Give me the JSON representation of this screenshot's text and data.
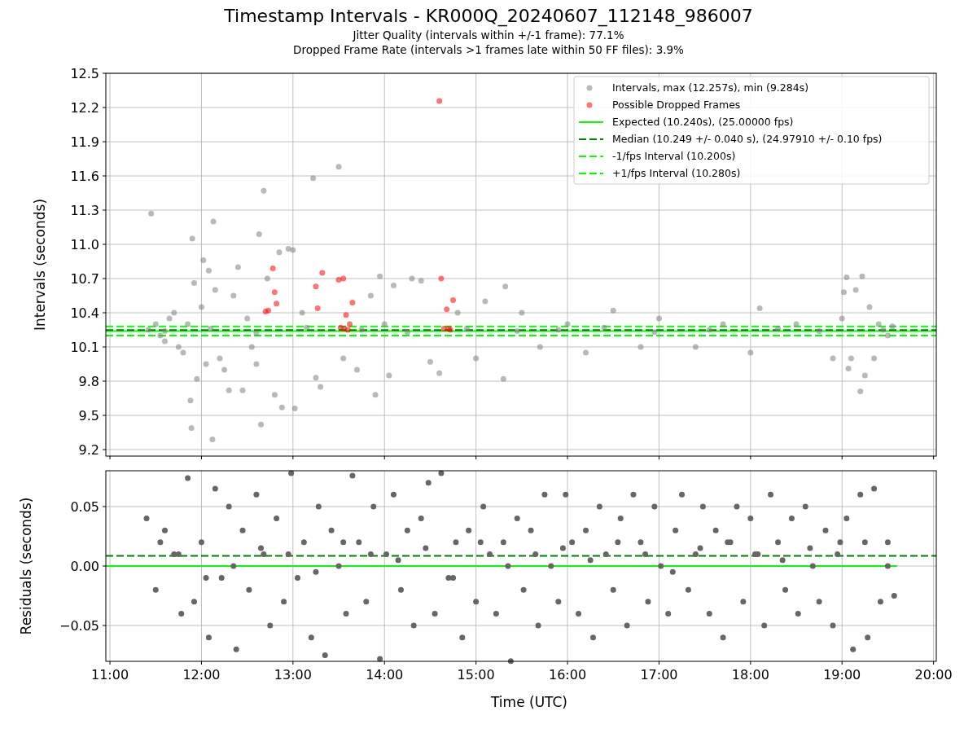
{
  "figure": {
    "title": "Timestamp Intervals - KR000Q_20240607_112148_986007",
    "subtitles": [
      "Jitter Quality (intervals within +/-1 frame): 77.1%",
      "Dropped Frame Rate (intervals >1 frames late within 50 FF files): 3.9%"
    ]
  },
  "charts": [
    {
      "chart_data": {
        "type": "scatter",
        "ylabel": "Intervals (seconds)",
        "xlim": [
          10.955,
          20.03
        ],
        "ylim": [
          9.143,
          12.5
        ],
        "grid": true,
        "legend": true,
        "yticks": [
          {
            "value": 9.2,
            "label": "9.2"
          },
          {
            "value": 9.5,
            "label": "9.5"
          },
          {
            "value": 9.8,
            "label": "9.8"
          },
          {
            "value": 10.1,
            "label": "10.1"
          },
          {
            "value": 10.4,
            "label": "10.4"
          },
          {
            "value": 10.7,
            "label": "10.7"
          },
          {
            "value": 11.0,
            "label": "11.0"
          },
          {
            "value": 11.3,
            "label": "11.3"
          },
          {
            "value": 11.6,
            "label": "11.6"
          },
          {
            "value": 11.9,
            "label": "11.9"
          },
          {
            "value": 12.2,
            "label": "12.2"
          },
          {
            "value": 12.5,
            "label": "12.5"
          }
        ],
        "series": [
          {
            "name": "Intervals, max (12.257s), min (9.284s)",
            "type": "scatter",
            "color": "#808080",
            "x": [
              11.45,
              11.42,
              11.5,
              11.55,
              11.6,
              11.65,
              11.7,
              11.75,
              11.8,
              11.85,
              11.88,
              11.89,
              11.9,
              11.92,
              11.95,
              12.0,
              12.02,
              12.05,
              12.08,
              12.12,
              12.13,
              12.15,
              12.2,
              12.25,
              12.3,
              12.35,
              12.4,
              12.45,
              12.5,
              12.55,
              12.6,
              12.63,
              12.65,
              12.68,
              12.72,
              12.8,
              12.85,
              12.88,
              12.95,
              13.0,
              13.02,
              13.1,
              13.22,
              13.25,
              13.3,
              13.5,
              13.55,
              13.7,
              13.85,
              13.9,
              13.95,
              14.0,
              14.05,
              14.1,
              14.3,
              14.4,
              14.5,
              14.6,
              14.8,
              15.0,
              15.1,
              15.3,
              15.32,
              15.5,
              15.7,
              16.0,
              16.2,
              16.5,
              16.8,
              17.0,
              17.4,
              17.7,
              18.0,
              18.1,
              18.5,
              18.9,
              19.0,
              19.02,
              19.05,
              19.07,
              19.1,
              19.15,
              19.2,
              19.22,
              19.25,
              19.3,
              19.35,
              19.4,
              19.5,
              19.55,
              11.6,
              12.1,
              12.6,
              13.15,
              13.75,
              14.25,
              14.9,
              15.45,
              15.9,
              16.4,
              16.95,
              17.55,
              18.3,
              18.75,
              19.45
            ],
            "values": [
              11.27,
              10.25,
              10.3,
              10.2,
              10.15,
              10.35,
              10.4,
              10.1,
              10.05,
              10.3,
              9.63,
              9.39,
              11.05,
              10.66,
              9.82,
              10.45,
              10.86,
              9.95,
              10.77,
              9.29,
              11.2,
              10.6,
              10.0,
              9.9,
              9.72,
              10.55,
              10.8,
              9.72,
              10.35,
              10.1,
              9.95,
              11.09,
              9.42,
              11.47,
              10.7,
              9.68,
              10.93,
              9.57,
              10.96,
              10.95,
              9.56,
              10.4,
              11.58,
              9.83,
              9.75,
              11.68,
              10.0,
              9.9,
              10.55,
              9.68,
              10.72,
              10.3,
              9.85,
              10.64,
              10.7,
              10.68,
              9.97,
              9.87,
              10.4,
              10.0,
              10.5,
              9.82,
              10.63,
              10.4,
              10.1,
              10.3,
              10.05,
              10.42,
              10.1,
              10.35,
              10.1,
              10.3,
              10.05,
              10.44,
              10.3,
              10.0,
              10.35,
              10.58,
              10.71,
              9.91,
              10.0,
              10.6,
              9.71,
              10.72,
              9.85,
              10.45,
              10.0,
              10.3,
              10.2,
              10.28,
              10.24,
              10.26,
              10.22,
              10.27,
              10.25,
              10.23,
              10.26,
              10.24,
              10.25,
              10.27,
              10.23,
              10.25,
              10.26,
              10.24,
              10.25
            ]
          },
          {
            "name": "Possible Dropped Frames",
            "type": "scatter",
            "color": "#ff0000",
            "x": [
              12.7,
              12.73,
              12.78,
              12.8,
              12.82,
              13.25,
              13.27,
              13.32,
              13.5,
              13.55,
              13.52,
              13.56,
              13.6,
              13.62,
              13.65,
              13.58,
              14.6,
              14.62,
              14.65,
              14.7,
              14.68,
              14.75,
              14.72
            ],
            "values": [
              10.41,
              10.42,
              10.79,
              10.58,
              10.48,
              10.63,
              10.44,
              10.75,
              10.69,
              10.7,
              10.27,
              10.26,
              10.25,
              10.3,
              10.49,
              10.38,
              12.257,
              10.7,
              10.26,
              10.26,
              10.43,
              10.51,
              10.25
            ]
          },
          {
            "name": "Expected (10.240s), (25.00000 fps)",
            "type": "line",
            "line_style": "solid",
            "color": "#00ff00",
            "x": [
              10.955,
              20.03
            ],
            "values": [
              10.24,
              10.24
            ]
          },
          {
            "name": "Median (10.249 +/- 0.040 s), (24.97910 +/- 0.10 fps)",
            "type": "line",
            "line_style": "dashed",
            "color": "#008000",
            "x": [
              10.955,
              20.03
            ],
            "values": [
              10.249,
              10.249
            ]
          },
          {
            "name": "-1/fps Interval (10.200s)",
            "type": "line",
            "line_style": "dashed",
            "color": "#00ff00",
            "x": [
              10.955,
              20.03
            ],
            "values": [
              10.2,
              10.2
            ]
          },
          {
            "name": "+1/fps Interval (10.280s)",
            "type": "line",
            "line_style": "dashed",
            "color": "#00ff00",
            "x": [
              10.955,
              20.03
            ],
            "values": [
              10.28,
              10.28
            ]
          }
        ]
      }
    },
    {
      "chart_data": {
        "type": "scatter",
        "xlabel": "Time (UTC)",
        "grid": true,
        "ylabel": "Residuals (seconds)",
        "xlim": [
          10.955,
          20.03
        ],
        "ylim": [
          -0.0801,
          0.0801
        ],
        "xticks": [
          {
            "value": 11,
            "label": "11:00"
          },
          {
            "value": 12,
            "label": "12:00"
          },
          {
            "value": 13,
            "label": "13:00"
          },
          {
            "value": 14,
            "label": "14:00"
          },
          {
            "value": 15,
            "label": "15:00"
          },
          {
            "value": 16,
            "label": "16:00"
          },
          {
            "value": 17,
            "label": "17:00"
          },
          {
            "value": 18,
            "label": "18:00"
          },
          {
            "value": 19,
            "label": "19:00"
          },
          {
            "value": 20,
            "label": "20:00"
          }
        ],
        "yticks": [
          {
            "value": -0.05,
            "label": "−0.05"
          },
          {
            "value": 0,
            "label": "0.00"
          },
          {
            "value": 0.05,
            "label": "0.05"
          }
        ],
        "series": [
          {
            "type": "scatter",
            "color": "#666666",
            "x": [
              11.4,
              11.5,
              11.6,
              11.7,
              11.78,
              11.85,
              11.92,
              12.0,
              12.08,
              12.15,
              12.22,
              12.3,
              12.38,
              12.45,
              12.52,
              12.6,
              12.68,
              12.75,
              12.82,
              12.9,
              12.98,
              13.05,
              13.12,
              13.2,
              13.28,
              13.35,
              13.42,
              13.5,
              13.58,
              13.65,
              13.72,
              13.8,
              13.88,
              13.95,
              14.02,
              14.1,
              14.18,
              14.25,
              14.32,
              14.4,
              14.48,
              14.55,
              14.62,
              14.7,
              14.78,
              14.85,
              14.92,
              15.0,
              15.08,
              15.15,
              15.22,
              15.3,
              15.38,
              15.45,
              15.52,
              15.6,
              15.68,
              15.75,
              15.82,
              15.9,
              15.98,
              16.05,
              16.12,
              16.2,
              16.28,
              16.35,
              16.42,
              16.5,
              16.58,
              16.65,
              16.72,
              16.8,
              16.88,
              16.95,
              17.02,
              17.1,
              17.18,
              17.25,
              17.32,
              17.4,
              17.48,
              17.55,
              17.62,
              17.7,
              17.78,
              17.85,
              17.92,
              18.0,
              18.08,
              18.15,
              18.22,
              18.3,
              18.38,
              18.45,
              18.52,
              18.6,
              18.68,
              18.75,
              18.82,
              18.9,
              18.98,
              19.05,
              19.12,
              19.2,
              19.28,
              19.35,
              19.42,
              19.5,
              19.57,
              11.55,
              11.75,
              12.05,
              12.35,
              12.65,
              12.95,
              13.25,
              13.55,
              13.85,
              14.15,
              14.45,
              14.75,
              15.05,
              15.35,
              15.65,
              15.95,
              16.25,
              16.55,
              16.85,
              17.15,
              17.45,
              17.75,
              18.05,
              18.35,
              18.65,
              18.95,
              19.25,
              19.5
            ],
            "values": [
              0.04,
              -0.02,
              0.03,
              0.01,
              -0.04,
              0.074,
              -0.03,
              0.02,
              -0.06,
              0.065,
              -0.01,
              0.05,
              -0.07,
              0.03,
              -0.02,
              0.06,
              0.01,
              -0.05,
              0.04,
              -0.03,
              0.078,
              -0.01,
              0.02,
              -0.06,
              0.05,
              -0.075,
              0.03,
              0.0,
              -0.04,
              0.076,
              0.02,
              -0.03,
              0.05,
              -0.078,
              0.01,
              0.06,
              -0.02,
              0.03,
              -0.05,
              0.04,
              0.07,
              -0.04,
              0.078,
              -0.01,
              0.02,
              -0.06,
              0.03,
              -0.03,
              0.05,
              0.01,
              -0.04,
              0.02,
              -0.08,
              0.04,
              -0.02,
              0.03,
              -0.05,
              0.06,
              0.0,
              -0.03,
              0.06,
              0.02,
              -0.04,
              0.03,
              -0.06,
              0.05,
              0.01,
              -0.02,
              0.04,
              -0.05,
              0.06,
              0.02,
              -0.03,
              0.05,
              0.0,
              -0.04,
              0.03,
              0.06,
              -0.02,
              0.01,
              0.05,
              -0.04,
              0.03,
              -0.06,
              0.02,
              0.05,
              -0.03,
              0.04,
              0.01,
              -0.05,
              0.06,
              0.02,
              -0.02,
              0.04,
              -0.04,
              0.05,
              0.0,
              -0.03,
              0.03,
              -0.05,
              0.02,
              0.04,
              -0.07,
              0.06,
              -0.06,
              0.065,
              -0.03,
              0.02,
              -0.025,
              0.02,
              0.01,
              -0.01,
              0.0,
              0.015,
              0.01,
              -0.005,
              0.02,
              0.01,
              0.005,
              0.015,
              -0.01,
              0.02,
              0.0,
              0.01,
              0.015,
              0.005,
              0.02,
              0.01,
              -0.005,
              0.015,
              0.02,
              0.01,
              0.005,
              0.015,
              0.01,
              0.02,
              0.0
            ]
          },
          {
            "type": "line",
            "line_style": "solid",
            "color": "#00ff00",
            "x": [
              10.955,
              19.6
            ],
            "values": [
              0,
              0
            ]
          },
          {
            "type": "line",
            "line_style": "dashed",
            "color": "#008000",
            "x": [
              10.955,
              20.03
            ],
            "values": [
              0.0085,
              0.0085
            ]
          }
        ]
      }
    }
  ]
}
